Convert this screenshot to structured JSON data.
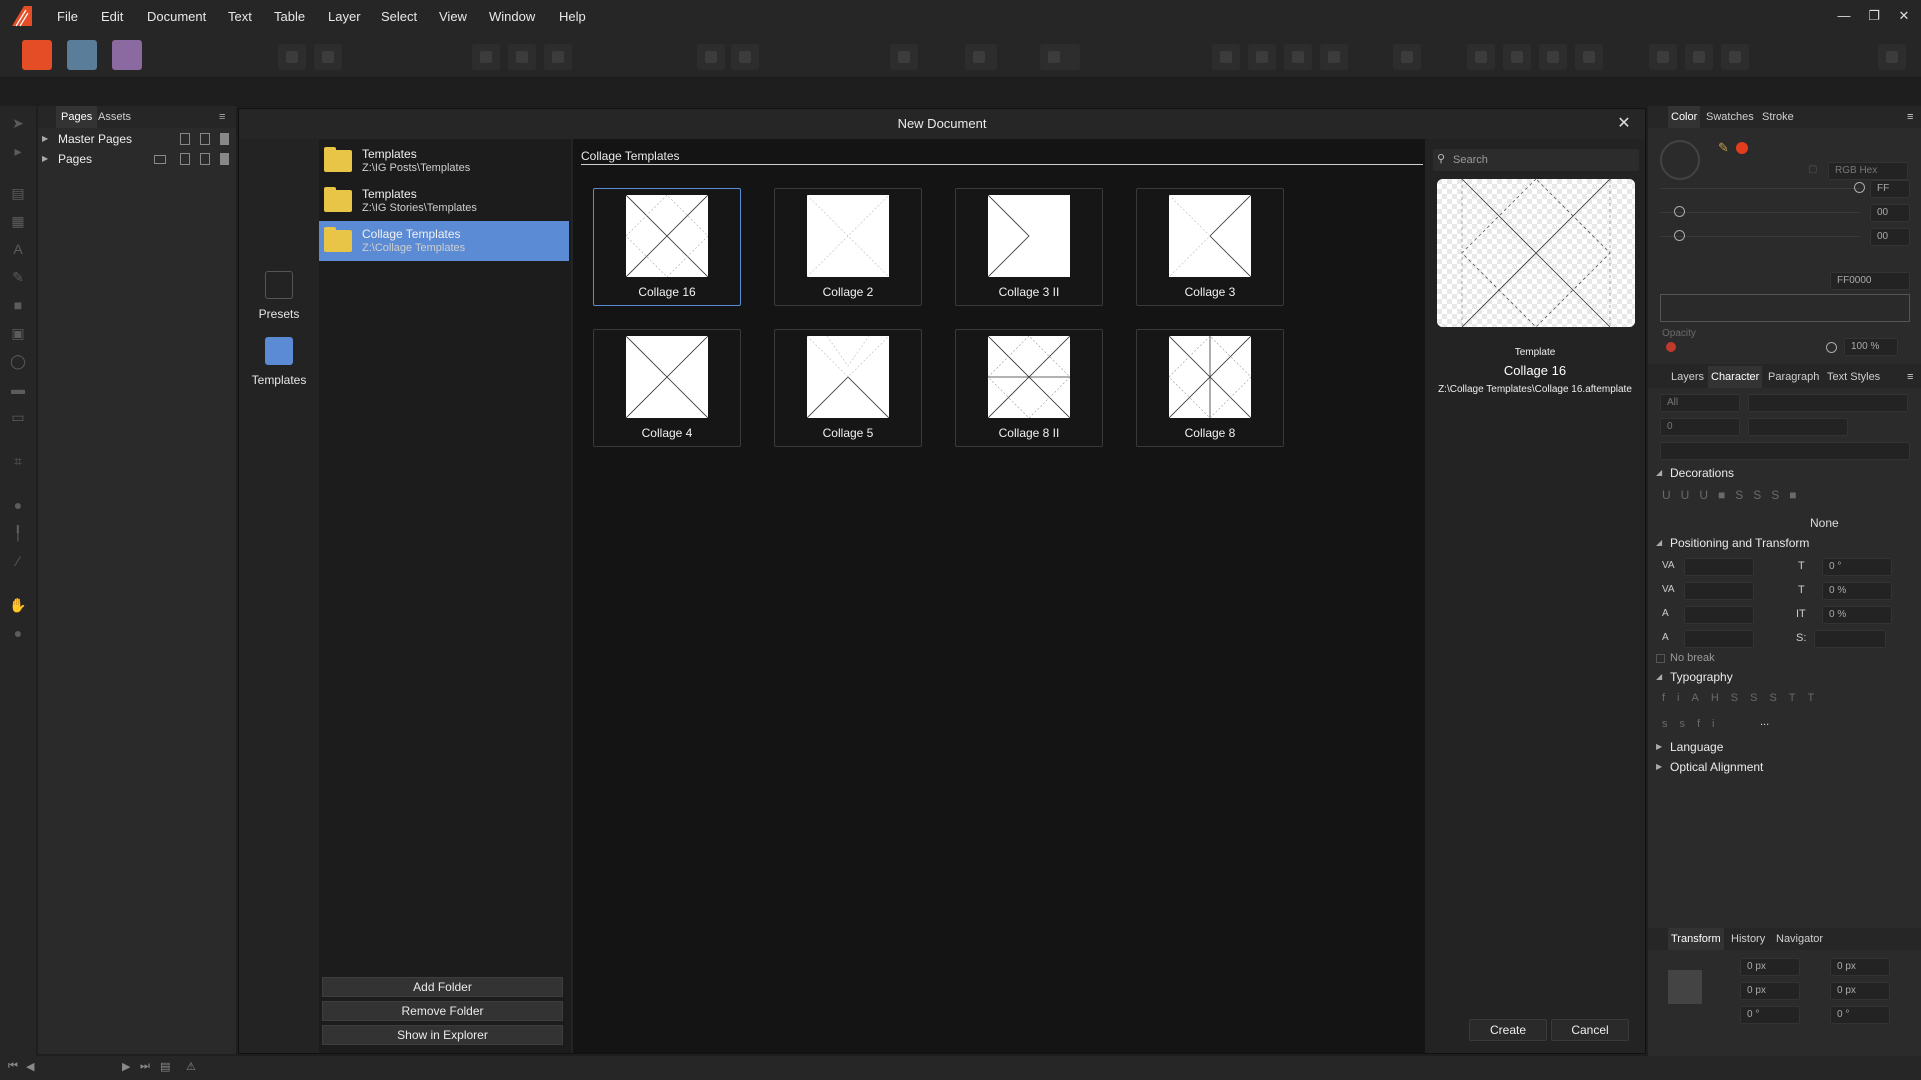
{
  "menu": [
    "File",
    "Edit",
    "Document",
    "Text",
    "Table",
    "Layer",
    "Select",
    "View",
    "Window",
    "Help"
  ],
  "window_controls": {
    "minimize": "—",
    "restore": "❐",
    "close": "✕"
  },
  "colors": {
    "accent": "#5b8bd4",
    "folder": "#e8c547",
    "brand": "#e44d26",
    "color_swatch": "#ff0000"
  },
  "pages_panel": {
    "tabs": [
      "Pages",
      "Assets"
    ],
    "items": [
      "Master Pages",
      "Pages"
    ]
  },
  "dialog": {
    "title": "New Document",
    "modes": [
      "Presets",
      "Templates"
    ],
    "folders": [
      {
        "name": "Templates",
        "path": "Z:\\IG Posts\\Templates"
      },
      {
        "name": "Templates",
        "path": "Z:\\IG Stories\\Templates"
      },
      {
        "name": "Collage Templates",
        "path": "Z:\\Collage Templates"
      }
    ],
    "folder_buttons": [
      "Add Folder",
      "Remove Folder",
      "Show in Explorer"
    ],
    "grid_title": "Collage Templates",
    "templates": [
      "Collage 16",
      "Collage 2",
      "Collage 3 II",
      "Collage 3",
      "Collage 4",
      "Collage 5",
      "Collage 8 II",
      "Collage 8"
    ],
    "search_placeholder": "Search",
    "preview": {
      "kind": "Template",
      "name": "Collage 16",
      "path": "Z:\\Collage Templates\\Collage 16.aftemplate"
    },
    "create_label": "Create",
    "cancel_label": "Cancel"
  },
  "right_panel": {
    "color_tabs": [
      "Color",
      "Swatches",
      "Stroke"
    ],
    "color_model": "RGB Hex",
    "r_value": "FF",
    "g_value": "00",
    "b_value": "00",
    "hex_value": "FF0000",
    "opacity_label": "Opacity",
    "opacity_value": "100 %",
    "char_tabs": [
      "Layers",
      "Character",
      "Paragraph",
      "Text Styles"
    ],
    "font_filter": "All",
    "font_size": "0",
    "decorations_label": "Decorations",
    "decoration_value": "None",
    "positioning_label": "Positioning and Transform",
    "shear_value": "0 °",
    "baseline_value": "0 %",
    "scale_value": "0 %",
    "s_label": "S:",
    "no_break": "No break",
    "typography_label": "Typography",
    "typo_more": "...",
    "language_label": "Language",
    "optical_label": "Optical Alignment",
    "transform_tabs": [
      "Transform",
      "History",
      "Navigator"
    ],
    "tx": "0 px",
    "ty": "0 px",
    "tw": "0 px",
    "th": "0 px",
    "tr": "0 °",
    "ts": "0 °"
  }
}
